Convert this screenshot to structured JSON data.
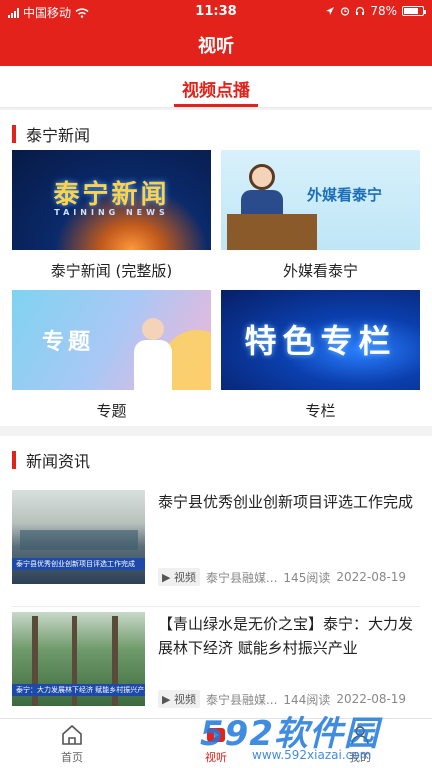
{
  "status_bar": {
    "carrier": "中国移动",
    "time": "11:38",
    "battery": "78%",
    "battery_level": 0.78
  },
  "header": {
    "title": "视听"
  },
  "tabs": [
    {
      "label": "视频点播",
      "active": true
    }
  ],
  "video_section": {
    "title": "泰宁新闻",
    "cards": [
      {
        "label": "泰宁新闻 (完整版)",
        "thumb_text": "泰宁新闻",
        "thumb_sub": "TAINING NEWS"
      },
      {
        "label": "外媒看泰宁",
        "thumb_text": "外媒看泰宁"
      },
      {
        "label": "专题",
        "thumb_text": "专题"
      },
      {
        "label": "专栏",
        "thumb_text": "特色专栏"
      }
    ]
  },
  "news_section": {
    "title": "新闻资讯",
    "items": [
      {
        "title": "泰宁县优秀创业创新项目评选工作完成",
        "tag": "视频",
        "source": "泰宁县融媒...",
        "reads": "145阅读",
        "date": "2022-08-19",
        "caption": "泰宁县优秀创业创新项目评选工作完成"
      },
      {
        "title": "【青山绿水是无价之宝】泰宁：大力发展林下经济 赋能乡村振兴产业",
        "tag": "视频",
        "source": "泰宁县融媒...",
        "reads": "144阅读",
        "date": "2022-08-19",
        "caption": "泰宁：大力发展林下经济 赋能乡村振兴产业"
      }
    ]
  },
  "tabbar": {
    "items": [
      {
        "label": "首页"
      },
      {
        "label": "视听",
        "active": true
      },
      {
        "label": "我的"
      }
    ]
  },
  "watermark": {
    "brand": "592软件园",
    "url": "www.592xiazai.com"
  },
  "colors": {
    "accent": "#e3231b",
    "watermark": "#1e78dc"
  }
}
